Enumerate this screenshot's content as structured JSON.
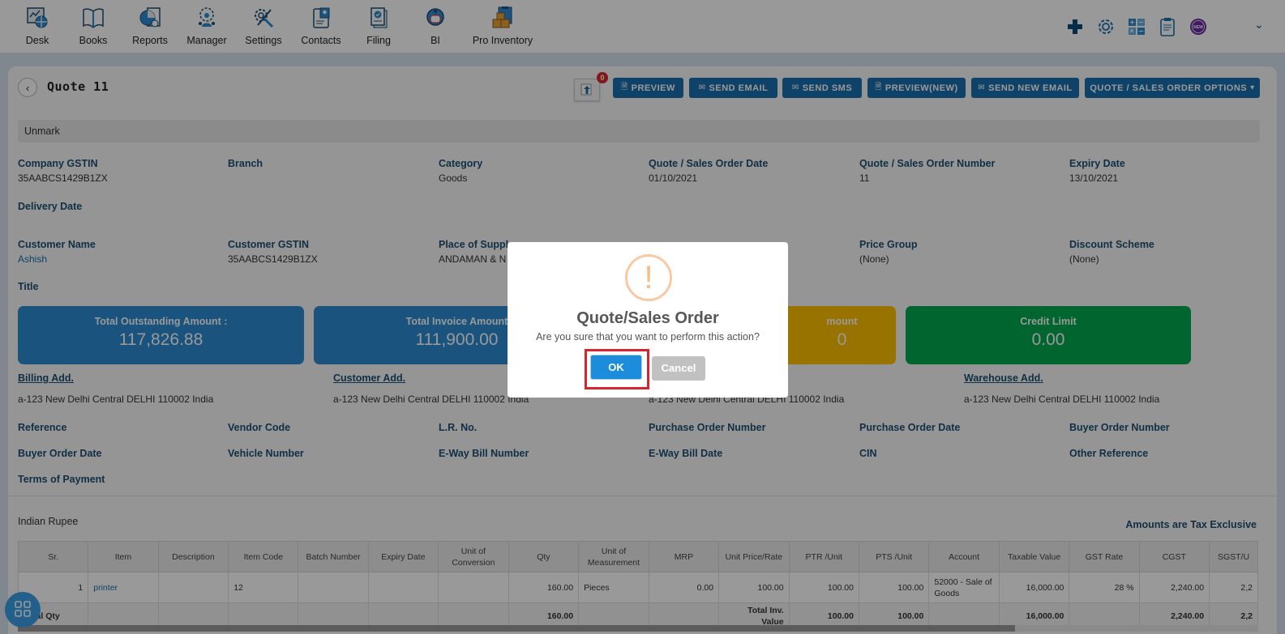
{
  "nav": {
    "items": [
      {
        "label": "Desk",
        "icon": "desk-icon"
      },
      {
        "label": "Books",
        "icon": "books-icon"
      },
      {
        "label": "Reports",
        "icon": "reports-icon"
      },
      {
        "label": "Manager",
        "icon": "manager-icon"
      },
      {
        "label": "Settings",
        "icon": "settings-tools-icon"
      },
      {
        "label": "Contacts",
        "icon": "contacts-icon"
      },
      {
        "label": "Filing",
        "icon": "filing-icon"
      },
      {
        "label": "BI",
        "icon": "bi-icon"
      },
      {
        "label": "Pro Inventory",
        "icon": "pro-inventory-icon"
      }
    ],
    "right_icons": [
      "plus-icon",
      "gear-icon",
      "calculator-icon",
      "clipboard-icon",
      "new-badge-icon"
    ],
    "new_badge_text": "NEW"
  },
  "header": {
    "title": "Quote 11",
    "notification_count": "0",
    "buttons": {
      "preview": "PREVIEW",
      "send_email": "SEND EMAIL",
      "send_sms": "SEND SMS",
      "preview_new": "PREVIEW(NEW)",
      "send_new_email": "SEND NEW EMAIL",
      "options": "QUOTE / SALES ORDER OPTIONS"
    },
    "unmark": "Unmark"
  },
  "fields": {
    "company_gstin": {
      "label": "Company GSTIN",
      "value": "35AABCS1429B1ZX"
    },
    "branch": {
      "label": "Branch",
      "value": ""
    },
    "category": {
      "label": "Category",
      "value": "Goods"
    },
    "order_date": {
      "label": "Quote / Sales Order Date",
      "value": "01/10/2021"
    },
    "order_number": {
      "label": "Quote / Sales Order Number",
      "value": "11"
    },
    "expiry_date": {
      "label": "Expiry Date",
      "value": "13/10/2021"
    },
    "delivery_date": {
      "label": "Delivery Date",
      "value": ""
    },
    "customer_name": {
      "label": "Customer Name",
      "value": "Ashish"
    },
    "customer_gstin": {
      "label": "Customer GSTIN",
      "value": "35AABCS1429B1ZX"
    },
    "place_of_supply": {
      "label": "Place of Suppl",
      "value": "ANDAMAN & N"
    },
    "price_group": {
      "label": "Price Group",
      "value": "(None)"
    },
    "discount_scheme": {
      "label": "Discount Scheme",
      "value": "(None)"
    },
    "title": {
      "label": "Title",
      "value": ""
    }
  },
  "cards": {
    "outstanding": {
      "label": "Total Outstanding Amount :",
      "value": "117,826.88",
      "color": "#2a8ad2"
    },
    "invoice": {
      "label": "Total Invoice Amount",
      "value": "111,900.00",
      "color": "#2a8ad2"
    },
    "third": {
      "label": "mount",
      "value": "0",
      "color": "#ffc000"
    },
    "credit": {
      "label": "Credit Limit",
      "value": "0.00",
      "color": "#00a94f"
    }
  },
  "addresses": {
    "billing": {
      "label": "Billing Add.",
      "value": "a-123 New Delhi Central DELHI 110002 India"
    },
    "customer": {
      "label": "Customer Add.",
      "value": "a-123 New Delhi Central DELHI 110002 India"
    },
    "shipping": {
      "value": "a-123 New Delhi Central DELHI 110002 India"
    },
    "warehouse": {
      "label": "Warehouse Add.",
      "value": "a-123 New Delhi Central DELHI 110002 India"
    }
  },
  "extra_fields": [
    "Reference",
    "Vendor Code",
    "L.R. No.",
    "Purchase Order Number",
    "Purchase Order Date",
    "Buyer Order Number",
    "Buyer Order Date",
    "Vehicle Number",
    "E-Way Bill Number",
    "E-Way Bill Date",
    "CIN",
    "Other Reference",
    "Terms of Payment"
  ],
  "currency": "Indian Rupee",
  "tax_note": "Amounts are Tax Exclusive",
  "table": {
    "headers": [
      "Sr.",
      "Item",
      "Description",
      "Item Code",
      "Batch Number",
      "Expiry Date",
      "Unit of Conversion",
      "Qty",
      "Unit of Measurement",
      "MRP",
      "Unit Price/Rate",
      "PTR /Unit",
      "PTS /Unit",
      "Account",
      "Taxable Value",
      "GST Rate",
      "CGST",
      "SGST/U"
    ],
    "rows": [
      [
        "1",
        "printer",
        "",
        "12",
        "",
        "",
        "",
        "160.00",
        "Pieces",
        "0.00",
        "100.00",
        "100.00",
        "100.00",
        "52000 - Sale of Goods",
        "16,000.00",
        "28 %",
        "2,240.00",
        "2,2"
      ]
    ],
    "total": [
      "Total Qty",
      "",
      "",
      "",
      "",
      "",
      "",
      "160.00",
      "",
      "",
      "Total Inv. Value",
      "100.00",
      "100.00",
      "",
      "16,000.00",
      "",
      "2,240.00",
      "2,2"
    ]
  },
  "modal": {
    "icon": "!",
    "title": "Quote/Sales Order",
    "text": "Are you sure that you want to perform this action?",
    "ok": "OK",
    "cancel": "Cancel"
  }
}
